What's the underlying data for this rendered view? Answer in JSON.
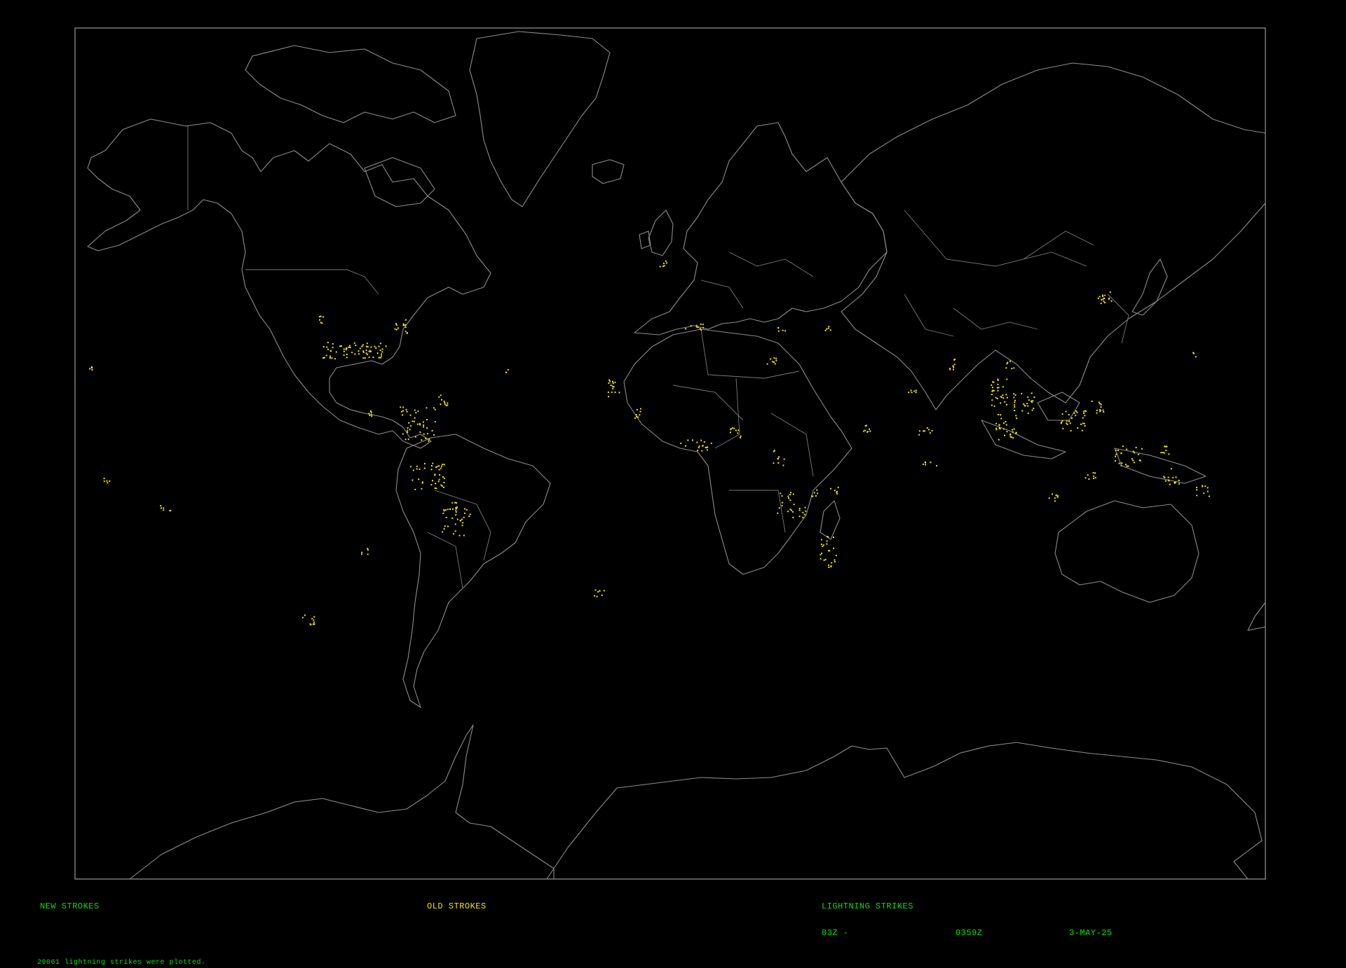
{
  "legend": {
    "new_strokes_label": "NEW STROKES",
    "old_strokes_label": "OLD STROKES",
    "title": "LIGHTNING STRIKES",
    "time_start": "03Z -",
    "time_end": "0359Z",
    "date": "3-MAY-25",
    "status": "29061 lightning strikes were plotted."
  },
  "colors": {
    "background": "#000000",
    "coastline": "#8c8c8c",
    "new_stroke": "#00e600",
    "old_stroke": "#f5e400",
    "frame": "#9a9a9a"
  },
  "map": {
    "projection": "Mercator",
    "coverage": "World"
  }
}
